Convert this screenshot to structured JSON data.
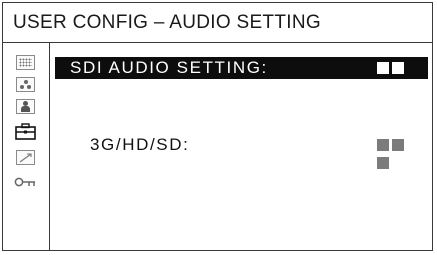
{
  "window": {
    "title": "USER CONFIG – AUDIO SETTING"
  },
  "sidebar": {
    "icons": [
      {
        "name": "menu-grid-icon"
      },
      {
        "name": "camera-dots-icon"
      },
      {
        "name": "person-icon"
      },
      {
        "name": "toolbox-icon",
        "active": true
      },
      {
        "name": "pencil-arrow-icon"
      },
      {
        "name": "key-icon"
      }
    ]
  },
  "menu": {
    "header": {
      "label": "SDI AUDIO SETTING:",
      "value_blocks": 3
    },
    "items": [
      {
        "label": "3G/HD/SD:",
        "value_blocks": 3
      }
    ]
  },
  "colors": {
    "header_bg": "#0d0d0d",
    "header_text": "#ffffff",
    "value_block_gray": "#7b7b7b",
    "border": "#3a3a3a"
  }
}
